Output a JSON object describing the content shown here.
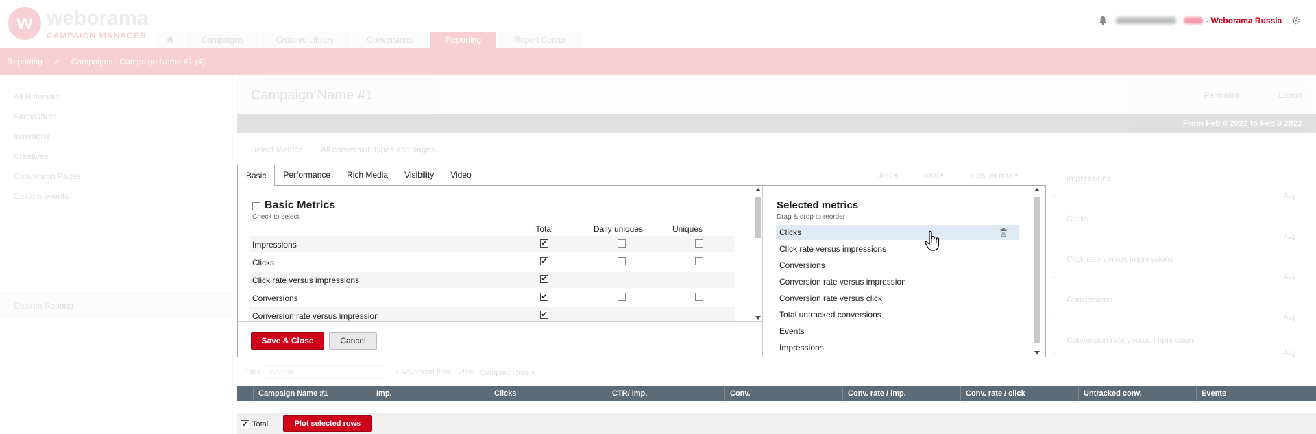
{
  "header": {
    "logo_letter": "w",
    "logo_brand": "weborama",
    "logo_sub": "CAMPAIGN MANAGER",
    "separator": "|",
    "account": "- Weborama Russia",
    "accent_color": "#d0021b"
  },
  "nav": {
    "tabs": [
      {
        "label": "Campaigns"
      },
      {
        "label": "Creative Library"
      },
      {
        "label": "Conversions"
      },
      {
        "label": "Reporting"
      },
      {
        "label": "Report Center"
      }
    ]
  },
  "breadcrumb": {
    "items": [
      "Reporting",
      ">",
      "Campaigns : Campaign Name #1 (4)"
    ]
  },
  "sidebar": {
    "items": [
      {
        "label": "All Networks"
      },
      {
        "label": "Sites/Offers"
      },
      {
        "label": "Insertions"
      },
      {
        "label": "Creatives"
      },
      {
        "label": "Conversion Pages"
      },
      {
        "label": "Custom events"
      }
    ],
    "section": "Custom Reports"
  },
  "campaign": {
    "title": "Campaign Name #1",
    "permalink": "Permalink",
    "export": "Export",
    "date_range": "From Feb 8 2022 to Feb 8 2022",
    "select_metrics": "Select Metrics",
    "conversion_types": "All conversion types and pages"
  },
  "right_controls": [
    "Lines ▾",
    "Total ▾",
    "Stats per hour ▾"
  ],
  "right_panel": {
    "items": [
      {
        "label": "Impressions",
        "avg": "Avg",
        "dash": "-"
      },
      {
        "label": "Clicks",
        "avg": "Avg",
        "dash": "-"
      },
      {
        "label": "Click rate versus impressions",
        "avg": "Avg",
        "dash": "-"
      },
      {
        "label": "Conversions",
        "avg": "Avg",
        "dash": "-"
      },
      {
        "label": "Conversion rate versus impression",
        "avg": "Avg",
        "dash": "-"
      }
    ]
  },
  "dialog": {
    "tabs": [
      {
        "label": "Basic"
      },
      {
        "label": "Performance"
      },
      {
        "label": "Rich Media"
      },
      {
        "label": "Visibility"
      },
      {
        "label": "Video"
      }
    ],
    "basic": {
      "title": "Basic Metrics",
      "subtitle": "Check to select",
      "columns": [
        "Total",
        "Daily uniques",
        "Uniques"
      ],
      "rows": [
        {
          "name": "Impressions",
          "total": "✔",
          "daily": "",
          "uniques": ""
        },
        {
          "name": "Clicks",
          "total": "✔",
          "daily": "",
          "uniques": ""
        },
        {
          "name": "Click rate versus impressions",
          "total": "✔"
        },
        {
          "name": "Conversions",
          "total": "✔",
          "daily": "",
          "uniques": ""
        },
        {
          "name": "Conversion rate versus impression",
          "total": "✔"
        }
      ]
    },
    "selected": {
      "title": "Selected metrics",
      "subtitle": "Drag & drop to reorder",
      "items": [
        "Clicks",
        "Click rate versus impressions",
        "Conversions",
        "Conversion rate versus impression",
        "Conversion rate versus click",
        "Total untracked conversions",
        "Events",
        "Impressions"
      ]
    },
    "save_label": "Save & Close",
    "cancel_label": "Cancel"
  },
  "filter": {
    "label": "Filter",
    "placeholder": "Search",
    "advanced": "+ Advanced filter",
    "view_label": "View",
    "view_value": "Campaign tree ▾"
  },
  "table": {
    "headers": [
      "Campaign Name #1",
      "Imp.",
      "Clicks",
      "CTR/ Imp.",
      "Conv.",
      "Conv. rate / imp.",
      "Conv. rate / click",
      "Untracked conv.",
      "Events"
    ]
  },
  "bottom": {
    "total_check": "✔",
    "total_label": "Total",
    "plot_label": "Plot selected rows"
  }
}
